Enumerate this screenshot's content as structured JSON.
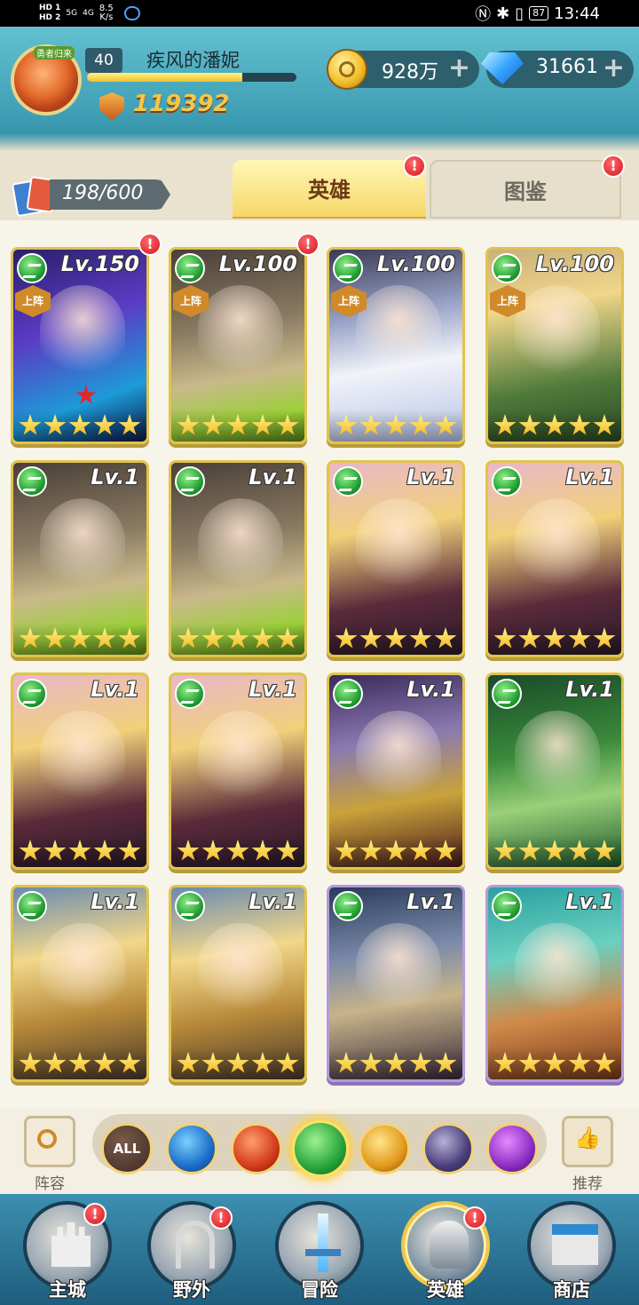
{
  "status_bar": {
    "network_top": "HD 1",
    "network_bottom": "HD 2",
    "signal_1": "5G",
    "signal_2": "4G",
    "speed_value": "8.5",
    "speed_unit": "K/s",
    "battery": "87",
    "time": "13:44"
  },
  "player": {
    "avatar_badge": "勇者归来",
    "level": "40",
    "name": "疾风的潘妮",
    "xp_fraction": 0.74,
    "power": "119392"
  },
  "resources": {
    "gold": "928万",
    "diamonds": "31661",
    "plus": "+"
  },
  "collection": {
    "count": "198/600"
  },
  "tabs": {
    "heroes": "英雄",
    "codex": "图鉴",
    "alert": "!"
  },
  "deployed_label": "上阵",
  "heroes": [
    {
      "level": "Lv.150",
      "deployed": true,
      "alert": true,
      "stars": 5,
      "theme": "shadow"
    },
    {
      "level": "Lv.100",
      "deployed": true,
      "alert": true,
      "stars": 5,
      "theme": "beast"
    },
    {
      "level": "Lv.100",
      "deployed": true,
      "alert": false,
      "stars": 5,
      "theme": "snow"
    },
    {
      "level": "Lv.100",
      "deployed": true,
      "alert": false,
      "stars": 5,
      "theme": "archer"
    },
    {
      "level": "Lv.1",
      "deployed": false,
      "alert": false,
      "stars": 5,
      "theme": "beast"
    },
    {
      "level": "Lv.1",
      "deployed": false,
      "alert": false,
      "stars": 5,
      "theme": "beast"
    },
    {
      "level": "Lv.1",
      "deployed": false,
      "alert": false,
      "stars": 5,
      "theme": "girl"
    },
    {
      "level": "Lv.1",
      "deployed": false,
      "alert": false,
      "stars": 5,
      "theme": "girl"
    },
    {
      "level": "Lv.1",
      "deployed": false,
      "alert": false,
      "stars": 5,
      "theme": "girl"
    },
    {
      "level": "Lv.1",
      "deployed": false,
      "alert": false,
      "stars": 5,
      "theme": "girl"
    },
    {
      "level": "Lv.1",
      "deployed": false,
      "alert": false,
      "stars": 5,
      "theme": "orc"
    },
    {
      "level": "Lv.1",
      "deployed": false,
      "alert": false,
      "stars": 5,
      "theme": "druid"
    },
    {
      "level": "Lv.1",
      "deployed": false,
      "alert": false,
      "stars": 5,
      "theme": "elf"
    },
    {
      "level": "Lv.1",
      "deployed": false,
      "alert": false,
      "stars": 5,
      "theme": "elf"
    },
    {
      "level": "Lv.1",
      "deployed": false,
      "alert": false,
      "stars": 5,
      "theme": "knight"
    },
    {
      "level": "Lv.1",
      "deployed": false,
      "alert": false,
      "stars": 5,
      "theme": "fox"
    }
  ],
  "filters": {
    "lineup_label": "阵容",
    "recommend_label": "推荐",
    "all_label": "ALL",
    "items": [
      "all",
      "water",
      "fire",
      "wind",
      "light",
      "dark",
      "chaos"
    ],
    "selected": "wind"
  },
  "nav": {
    "items": [
      {
        "label": "主城",
        "alert": true
      },
      {
        "label": "野外",
        "alert": true
      },
      {
        "label": "冒险",
        "alert": false
      },
      {
        "label": "英雄",
        "alert": true
      },
      {
        "label": "商店",
        "alert": false
      }
    ],
    "active_index": 3
  },
  "colors": {
    "header": "#3f9fb5",
    "card_border": "#e1c34e",
    "alert": "#d4141b",
    "star": "#f2b41c"
  }
}
